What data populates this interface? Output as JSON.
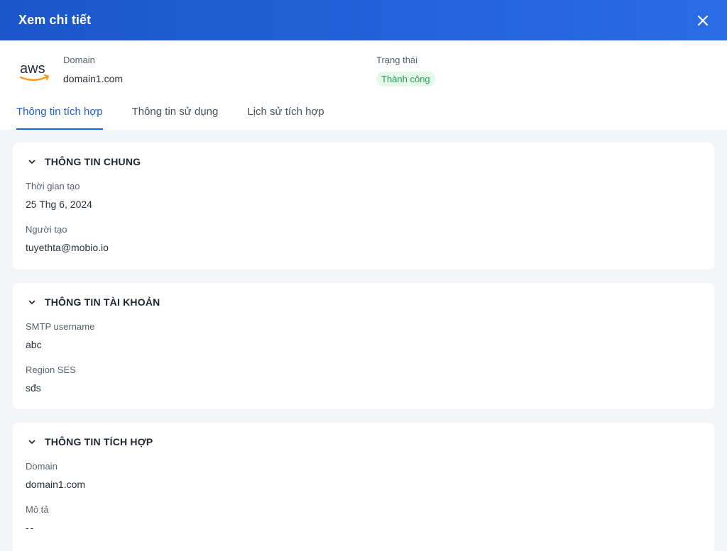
{
  "header": {
    "title": "Xem chi tiết"
  },
  "summary": {
    "domain_label": "Domain",
    "domain_value": "domain1.com",
    "status_label": "Trạng thái",
    "status_value": "Thành công",
    "logo_text": "aws"
  },
  "tabs": [
    {
      "label": "Thông tin tích hợp",
      "active": true
    },
    {
      "label": "Thông tin sử dụng",
      "active": false
    },
    {
      "label": "Lịch sử tích hợp",
      "active": false
    }
  ],
  "sections": [
    {
      "title": "THÔNG TIN CHUNG",
      "fields": [
        {
          "label": "Thời gian tạo",
          "value": "25 Thg 6, 2024"
        },
        {
          "label": "Người tạo",
          "value": "tuyethta@mobio.io"
        }
      ]
    },
    {
      "title": "THÔNG TIN TÀI KHOẢN",
      "fields": [
        {
          "label": "SMTP username",
          "value": "abc"
        },
        {
          "label": "Region SES",
          "value": "sđs"
        }
      ]
    },
    {
      "title": "THÔNG TIN TÍCH HỢP",
      "fields": [
        {
          "label": "Domain",
          "value": "domain1.com"
        },
        {
          "label": "Mô tả",
          "value": "--"
        }
      ]
    }
  ],
  "colors": {
    "header_bg": "#1f5fd6",
    "accent": "#1f5fd6",
    "status_bg": "#e6f7ec",
    "status_text": "#1fa653",
    "aws_orange": "#f79a1e"
  },
  "icons": {
    "close": "close-icon",
    "chevron": "chevron-down-icon",
    "logo": "aws-logo"
  }
}
